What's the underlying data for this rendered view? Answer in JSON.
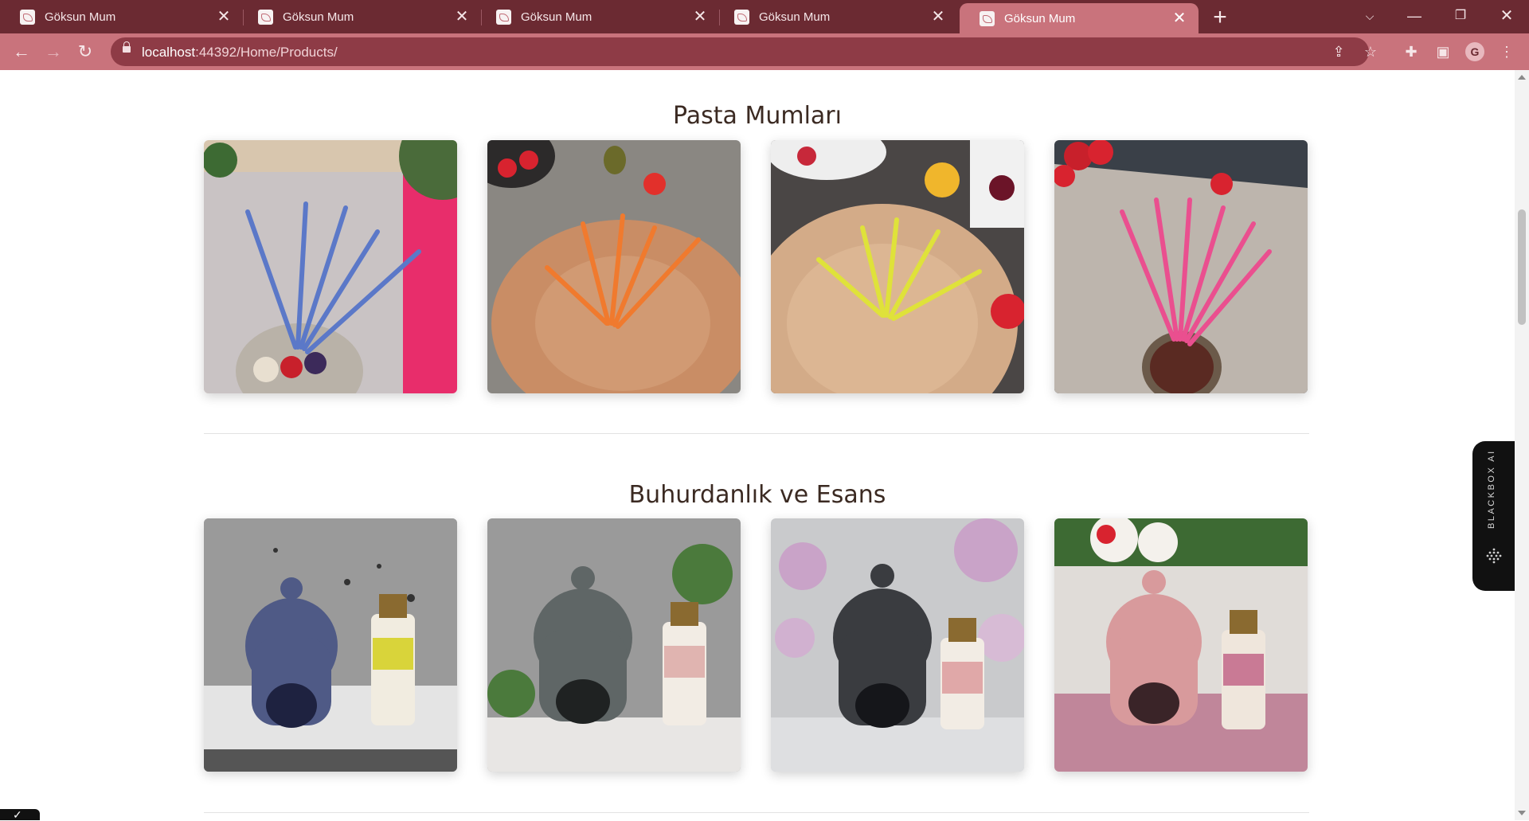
{
  "browser": {
    "tabs": [
      {
        "title": "Göksun Mum",
        "active": false
      },
      {
        "title": "Göksun Mum",
        "active": false
      },
      {
        "title": "Göksun Mum",
        "active": false
      },
      {
        "title": "Göksun Mum",
        "active": false
      },
      {
        "title": "Göksun Mum",
        "active": true
      }
    ],
    "url_host": "localhost",
    "url_path": ":44392/Home/Products/",
    "profile_initial": "G",
    "accent_color": "#c9737c",
    "tabbar_color": "#6b2a32"
  },
  "sections": [
    {
      "title": "Pasta Mumları",
      "products": [
        {
          "image": "blue-birthday-candles",
          "candle_color": "#5b78c8"
        },
        {
          "image": "orange-birthday-candles",
          "candle_color": "#f07a2e"
        },
        {
          "image": "yellow-birthday-candles",
          "candle_color": "#dfe23a"
        },
        {
          "image": "pink-birthday-candles",
          "candle_color": "#ea4f8f"
        }
      ]
    },
    {
      "title": "Buhurdanlık ve Esans",
      "products": [
        {
          "image": "blue-oil-burner-with-essence",
          "burner_color": "#4f5a86"
        },
        {
          "image": "grey-oil-burner-with-essence",
          "burner_color": "#5f6666"
        },
        {
          "image": "black-oil-burner-with-essence",
          "burner_color": "#3a3c40"
        },
        {
          "image": "pink-oil-burner-with-essence",
          "burner_color": "#d89a9c"
        }
      ]
    }
  ],
  "widget": {
    "label": "BLACKBOX AI"
  }
}
